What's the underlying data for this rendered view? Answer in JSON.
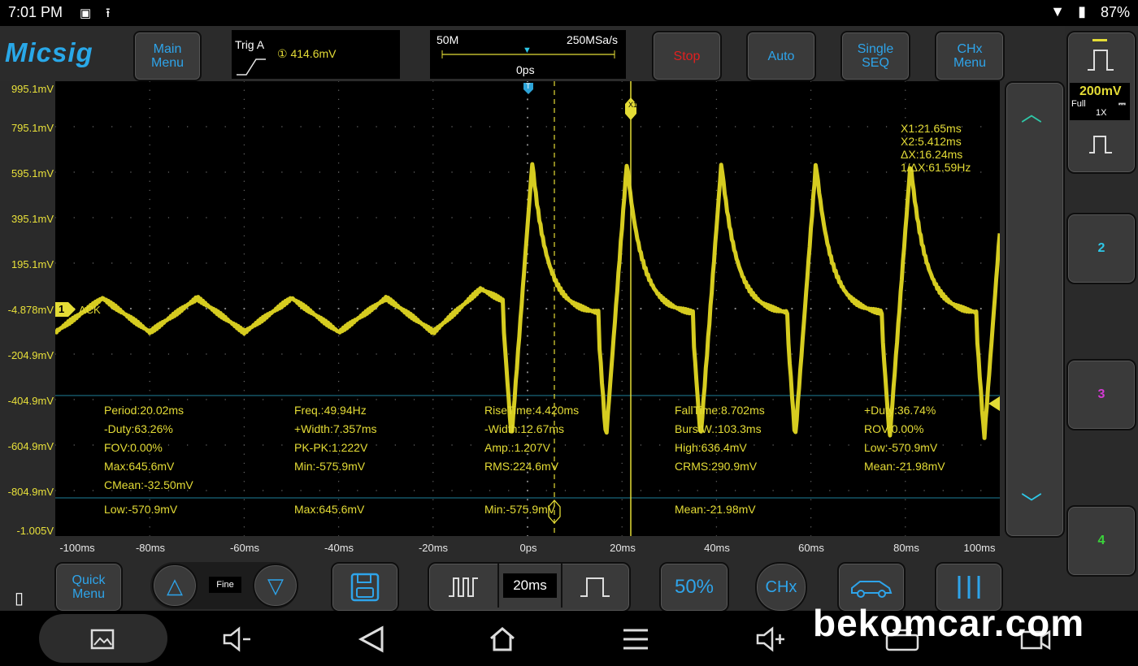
{
  "status": {
    "time": "7:01 PM",
    "battery": "87%"
  },
  "brand": "Micsig",
  "toolbar": {
    "main_menu": "Main\nMenu",
    "trig_title": "Trig A",
    "trig_level": "① 414.6mV",
    "memory": "50M",
    "sample_rate": "250MSa/s",
    "time_offset": "0ps",
    "stop": "Stop",
    "auto": "Auto",
    "single": "Single\nSEQ",
    "chx_menu": "CHx\nMenu"
  },
  "yaxis": [
    "995.1mV",
    "795.1mV",
    "595.1mV",
    "395.1mV",
    "195.1mV",
    "-4.878mV",
    "-204.9mV",
    "-404.9mV",
    "-604.9mV",
    "-804.9mV",
    "-1.005V"
  ],
  "xaxis": [
    "-100ms",
    "-80ms",
    "-60ms",
    "-40ms",
    "-20ms",
    "0ps",
    "20ms",
    "40ms",
    "60ms",
    "80ms",
    "100ms"
  ],
  "channel": {
    "number": "1",
    "label": "ACK",
    "trigger_marker": "T",
    "cursor_x1": "X1",
    "cursor_x2": "X2"
  },
  "cursors": [
    "X1:21.65ms",
    "X2:5.412ms",
    "ΔX:16.24ms",
    "1/ΔX:61.59Hz"
  ],
  "measurements": {
    "col1": [
      "Period:20.02ms",
      "-Duty:63.26%",
      "FOV:0.00%",
      "Max:645.6mV",
      "CMean:-32.50mV"
    ],
    "col2": [
      "Freq.:49.94Hz",
      "+Width:7.357ms",
      "PK-PK:1.222V",
      "Min:-575.9mV"
    ],
    "col3": [
      "RiseTime:4.420ms",
      "-Width:12.67ms",
      "Amp.:1.207V",
      "RMS:224.6mV"
    ],
    "col4": [
      "FallTime:8.702ms",
      "BurstW.:103.3ms",
      "High:636.4mV",
      "CRMS:290.9mV"
    ],
    "col5": [
      "+Duty:36.74%",
      "ROV:0.00%",
      "Low:-570.9mV",
      "Mean:-21.98mV"
    ],
    "bottom": [
      "Low:-570.9mV",
      "Max:645.6mV",
      "Min:-575.9mV",
      "Mean:-21.98mV"
    ]
  },
  "right_panel": {
    "volts_div": "200mV",
    "coupling": "Full",
    "probe": "1X",
    "ch2": "2",
    "ch3": "3",
    "ch4": "4"
  },
  "bottom": {
    "quick_menu": "Quick\nMenu",
    "fine": "Fine",
    "timebase": "20ms",
    "fifty": "50%",
    "chx": "CHx"
  },
  "watermark": "bekomcar.com",
  "colors": {
    "ch1": "#e6dc2a",
    "ch2": "#2ec8e8",
    "ch3": "#d43ad4",
    "ch4": "#3ad43a",
    "accent": "#2ea4ea",
    "stop": "#e02020"
  },
  "waveform": {
    "cycle_ms": 20.02,
    "low_mV": -570.9,
    "high_mV": 645.6,
    "pre_trigger_amplitude_mV": [
      -100,
      50
    ]
  }
}
